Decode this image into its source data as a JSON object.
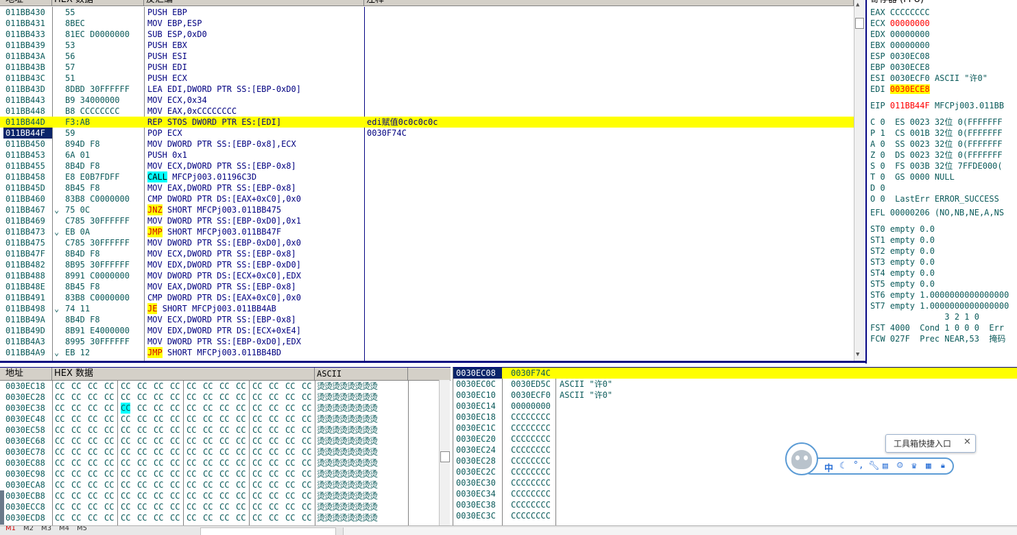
{
  "cpu": {
    "headers": [
      "地址",
      "HEX 数据",
      "反汇编",
      "注释"
    ],
    "rows": [
      {
        "addr": "011BB430",
        "hex": "55",
        "asm": "PUSH EBP"
      },
      {
        "addr": "011BB431",
        "hex": "8BEC",
        "asm": "MOV EBP,ESP"
      },
      {
        "addr": "011BB433",
        "hex": "81EC D0000000",
        "asm": "SUB ESP,0xD0"
      },
      {
        "addr": "011BB439",
        "hex": "53",
        "asm": "PUSH EBX"
      },
      {
        "addr": "011BB43A",
        "hex": "56",
        "asm": "PUSH ESI"
      },
      {
        "addr": "011BB43B",
        "hex": "57",
        "asm": "PUSH EDI"
      },
      {
        "addr": "011BB43C",
        "hex": "51",
        "asm": "PUSH ECX"
      },
      {
        "addr": "011BB43D",
        "hex": "8DBD 30FFFFFF",
        "asm": "LEA EDI,DWORD PTR SS:[EBP-0xD0]"
      },
      {
        "addr": "011BB443",
        "hex": "B9 34000000",
        "asm": "MOV ECX,0x34"
      },
      {
        "addr": "011BB448",
        "hex": "B8 CCCCCCCC",
        "asm": "MOV EAX,0xCCCCCCCC"
      },
      {
        "addr": "011BB44D",
        "hex": "F3:AB",
        "asm": "REP STOS DWORD PTR ES:[EDI]",
        "comment": "edi赋值0c0c0c0c",
        "hl": "yellow"
      },
      {
        "addr": "011BB44F",
        "hex": "59",
        "asm": "POP ECX",
        "comment": "0030F74C",
        "hl": "current"
      },
      {
        "addr": "011BB450",
        "hex": "894D F8",
        "asm": "MOV DWORD PTR SS:[EBP-0x8],ECX"
      },
      {
        "addr": "011BB453",
        "hex": "6A 01",
        "asm": "PUSH 0x1"
      },
      {
        "addr": "011BB455",
        "hex": "8B4D F8",
        "asm": "MOV ECX,DWORD PTR SS:[EBP-0x8]"
      },
      {
        "addr": "011BB458",
        "hex": "E8 E0B7FDFF",
        "mn": "CALL",
        "mnStyle": "call",
        "rest": " MFCPj003.01196C3D"
      },
      {
        "addr": "011BB45D",
        "hex": "8B45 F8",
        "asm": "MOV EAX,DWORD PTR SS:[EBP-0x8]"
      },
      {
        "addr": "011BB460",
        "hex": "83B8 C0000000",
        "asm": "CMP DWORD PTR DS:[EAX+0xC0],0x0"
      },
      {
        "addr": "011BB467",
        "mark": "⌄",
        "hex": "75 0C",
        "mn": "JNZ",
        "mnStyle": "jmp",
        "rest": " SHORT MFCPj003.011BB475"
      },
      {
        "addr": "011BB469",
        "hex": "C785 30FFFFFF",
        "asm": "MOV DWORD PTR SS:[EBP-0xD0],0x1"
      },
      {
        "addr": "011BB473",
        "mark": "⌄",
        "hex": "EB 0A",
        "mn": "JMP",
        "mnStyle": "jmp",
        "rest": " SHORT MFCPj003.011BB47F"
      },
      {
        "addr": "011BB475",
        "hex": "C785 30FFFFFF",
        "asm": "MOV DWORD PTR SS:[EBP-0xD0],0x0"
      },
      {
        "addr": "011BB47F",
        "hex": "8B4D F8",
        "asm": "MOV ECX,DWORD PTR SS:[EBP-0x8]"
      },
      {
        "addr": "011BB482",
        "hex": "8B95 30FFFFFF",
        "asm": "MOV EDX,DWORD PTR SS:[EBP-0xD0]"
      },
      {
        "addr": "011BB488",
        "hex": "8991 C0000000",
        "asm": "MOV DWORD PTR DS:[ECX+0xC0],EDX"
      },
      {
        "addr": "011BB48E",
        "hex": "8B45 F8",
        "asm": "MOV EAX,DWORD PTR SS:[EBP-0x8]"
      },
      {
        "addr": "011BB491",
        "hex": "83B8 C0000000",
        "asm": "CMP DWORD PTR DS:[EAX+0xC0],0x0"
      },
      {
        "addr": "011BB498",
        "mark": "⌄",
        "hex": "74 11",
        "mn": "JE",
        "mnStyle": "jmp",
        "rest": " SHORT MFCPj003.011BB4AB"
      },
      {
        "addr": "011BB49A",
        "hex": "8B4D F8",
        "asm": "MOV ECX,DWORD PTR SS:[EBP-0x8]"
      },
      {
        "addr": "011BB49D",
        "hex": "8B91 E4000000",
        "asm": "MOV EDX,DWORD PTR DS:[ECX+0xE4]"
      },
      {
        "addr": "011BB4A3",
        "hex": "8995 30FFFFFF",
        "asm": "MOV DWORD PTR SS:[EBP-0xD0],EDX"
      },
      {
        "addr": "011BB4A9",
        "mark": "⌄",
        "hex": "EB 12",
        "mn": "JMP",
        "mnStyle": "jmp",
        "rest": " SHORT MFCPj003.011BB4BD"
      }
    ]
  },
  "registers": {
    "title": "寄存器 (FPU)",
    "gp": [
      {
        "name": "EAX",
        "value": "CCCCCCCC"
      },
      {
        "name": "ECX",
        "value": "00000000",
        "style": "red"
      },
      {
        "name": "EDX",
        "value": "00000000"
      },
      {
        "name": "EBX",
        "value": "00000000"
      },
      {
        "name": "ESP",
        "value": "0030EC08"
      },
      {
        "name": "EBP",
        "value": "0030ECE8"
      },
      {
        "name": "ESI",
        "value": "0030ECF0",
        "extra": " ASCII \"许0\""
      },
      {
        "name": "EDI",
        "value": "0030ECE8",
        "style": "redyellow"
      }
    ],
    "eip": {
      "name": "EIP",
      "value": "011BB44F",
      "extra": " MFCPj003.011BB"
    },
    "flags": [
      "C 0  ES 0023 32位 0(FFFFFFF",
      "P 1  CS 001B 32位 0(FFFFFFF",
      "A 0  SS 0023 32位 0(FFFFFFF",
      "Z 0  DS 0023 32位 0(FFFFFFF",
      "S 0  FS 003B 32位 7FFDE000(",
      "T 0  GS 0000 NULL",
      "D 0",
      "O 0  LastErr ERROR_SUCCESS"
    ],
    "efl": "EFL 00000206 (NO,NB,NE,A,NS",
    "fpu": [
      "ST0 empty 0.0",
      "ST1 empty 0.0",
      "ST2 empty 0.0",
      "ST3 empty 0.0",
      "ST4 empty 0.0",
      "ST5 empty 0.0",
      "ST6 empty 1.0000000000000000",
      "ST7 empty 1.0000000000000000"
    ],
    "bits": "               3 2 1 0",
    "fst": "FST 4000  Cond 1 0 0 0  Err",
    "fcw": "FCW 027F  Prec NEAR,53  掩码"
  },
  "dump": {
    "headers": [
      "地址",
      "HEX 数据",
      "ASCII"
    ],
    "addrs": [
      "0030EC18",
      "0030EC28",
      "0030EC38",
      "0030EC48",
      "0030EC58",
      "0030EC68",
      "0030EC78",
      "0030EC88",
      "0030EC98",
      "0030ECA8",
      "0030ECB8",
      "0030ECC8",
      "0030ECD8"
    ],
    "byte": "CC",
    "ascii": "烫烫烫烫烫烫烫烫",
    "highlight": {
      "row": 2,
      "byte": 4
    }
  },
  "stack": {
    "rows": [
      {
        "addr": "0030EC08",
        "value": "0030F74C",
        "hl": true
      },
      {
        "addr": "0030EC0C",
        "value": "0030ED5C",
        "comment": "ASCII \"许0\""
      },
      {
        "addr": "0030EC10",
        "value": "0030ECF0",
        "comment": "ASCII \"许0\""
      },
      {
        "addr": "0030EC14",
        "value": "00000000"
      },
      {
        "addr": "0030EC18",
        "value": "CCCCCCCC"
      },
      {
        "addr": "0030EC1C",
        "value": "CCCCCCCC"
      },
      {
        "addr": "0030EC20",
        "value": "CCCCCCCC"
      },
      {
        "addr": "0030EC24",
        "value": "CCCCCCCC"
      },
      {
        "addr": "0030EC28",
        "value": "CCCCCCCC"
      },
      {
        "addr": "0030EC2C",
        "value": "CCCCCCCC"
      },
      {
        "addr": "0030EC30",
        "value": "CCCCCCCC"
      },
      {
        "addr": "0030EC34",
        "value": "CCCCCCCC"
      },
      {
        "addr": "0030EC38",
        "value": "CCCCCCCC"
      },
      {
        "addr": "0030EC3C",
        "value": "CCCCCCCC"
      }
    ]
  },
  "widget": {
    "tooltip": "工具箱快捷入口",
    "close": "✕",
    "ime_label": "中",
    "icons": [
      "moon-icon",
      "punctuation-icon",
      "wrench-icon",
      "clipboard-icon",
      "emoji-icon",
      "shirt-icon",
      "grid-icon",
      "lock-icon"
    ]
  },
  "statusbar": {
    "tabs": [
      "M1",
      "M2",
      "M3",
      "M4",
      "M5"
    ]
  },
  "colors": {
    "accent": "#000080",
    "highlight": "#ffff00",
    "select": "#0a246a",
    "call": "#00ffff",
    "text": "#0a5a5a"
  }
}
